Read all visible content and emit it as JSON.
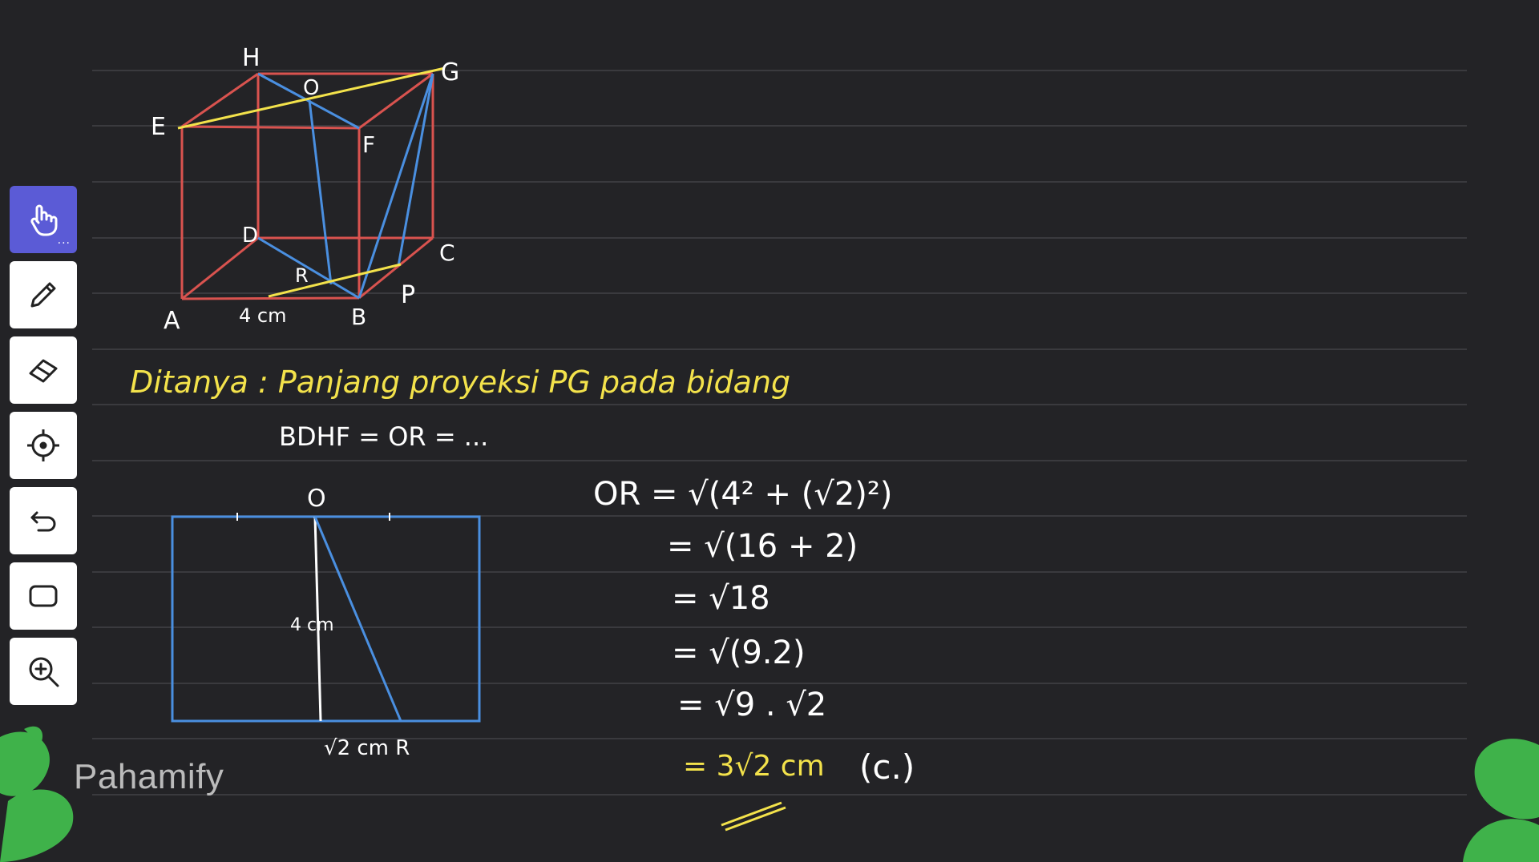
{
  "cube": {
    "labels": {
      "H": "H",
      "G": "G",
      "O": "O",
      "E": "E",
      "F": "F",
      "D": "D",
      "C": "C",
      "R": "R",
      "A": "A",
      "B": "B",
      "P": "P",
      "edge": "4 cm"
    }
  },
  "question": {
    "line1": "Ditanya : Panjang proyeksi PG pada bidang",
    "line2": "BDHF = OR = ..."
  },
  "rectangle": {
    "top_label": "O",
    "side_label": "4 cm",
    "bottom_label": "√2 cm R"
  },
  "solution": {
    "step1": "OR = √(4² + (√2)²)",
    "step2": "= √(16 + 2)",
    "step3": "= √18",
    "step4": "= √(9.2)",
    "step5": "= √9 . √2",
    "step6": "= 3√2 cm",
    "answer": "(c.)"
  },
  "toolbar": {
    "items": [
      "hand-icon",
      "pencil-icon",
      "eraser-icon",
      "laser-pointer-icon",
      "undo-icon",
      "shape-icon",
      "zoom-icon"
    ]
  },
  "watermark": "Pahamify",
  "colors": {
    "background": "#232326",
    "red_edges": "#d9534f",
    "blue_lines": "#4a8fe0",
    "yellow_lines": "#f3e24b",
    "toolbar_active": "#5b5bd6",
    "leaf": "#3fb24a"
  }
}
